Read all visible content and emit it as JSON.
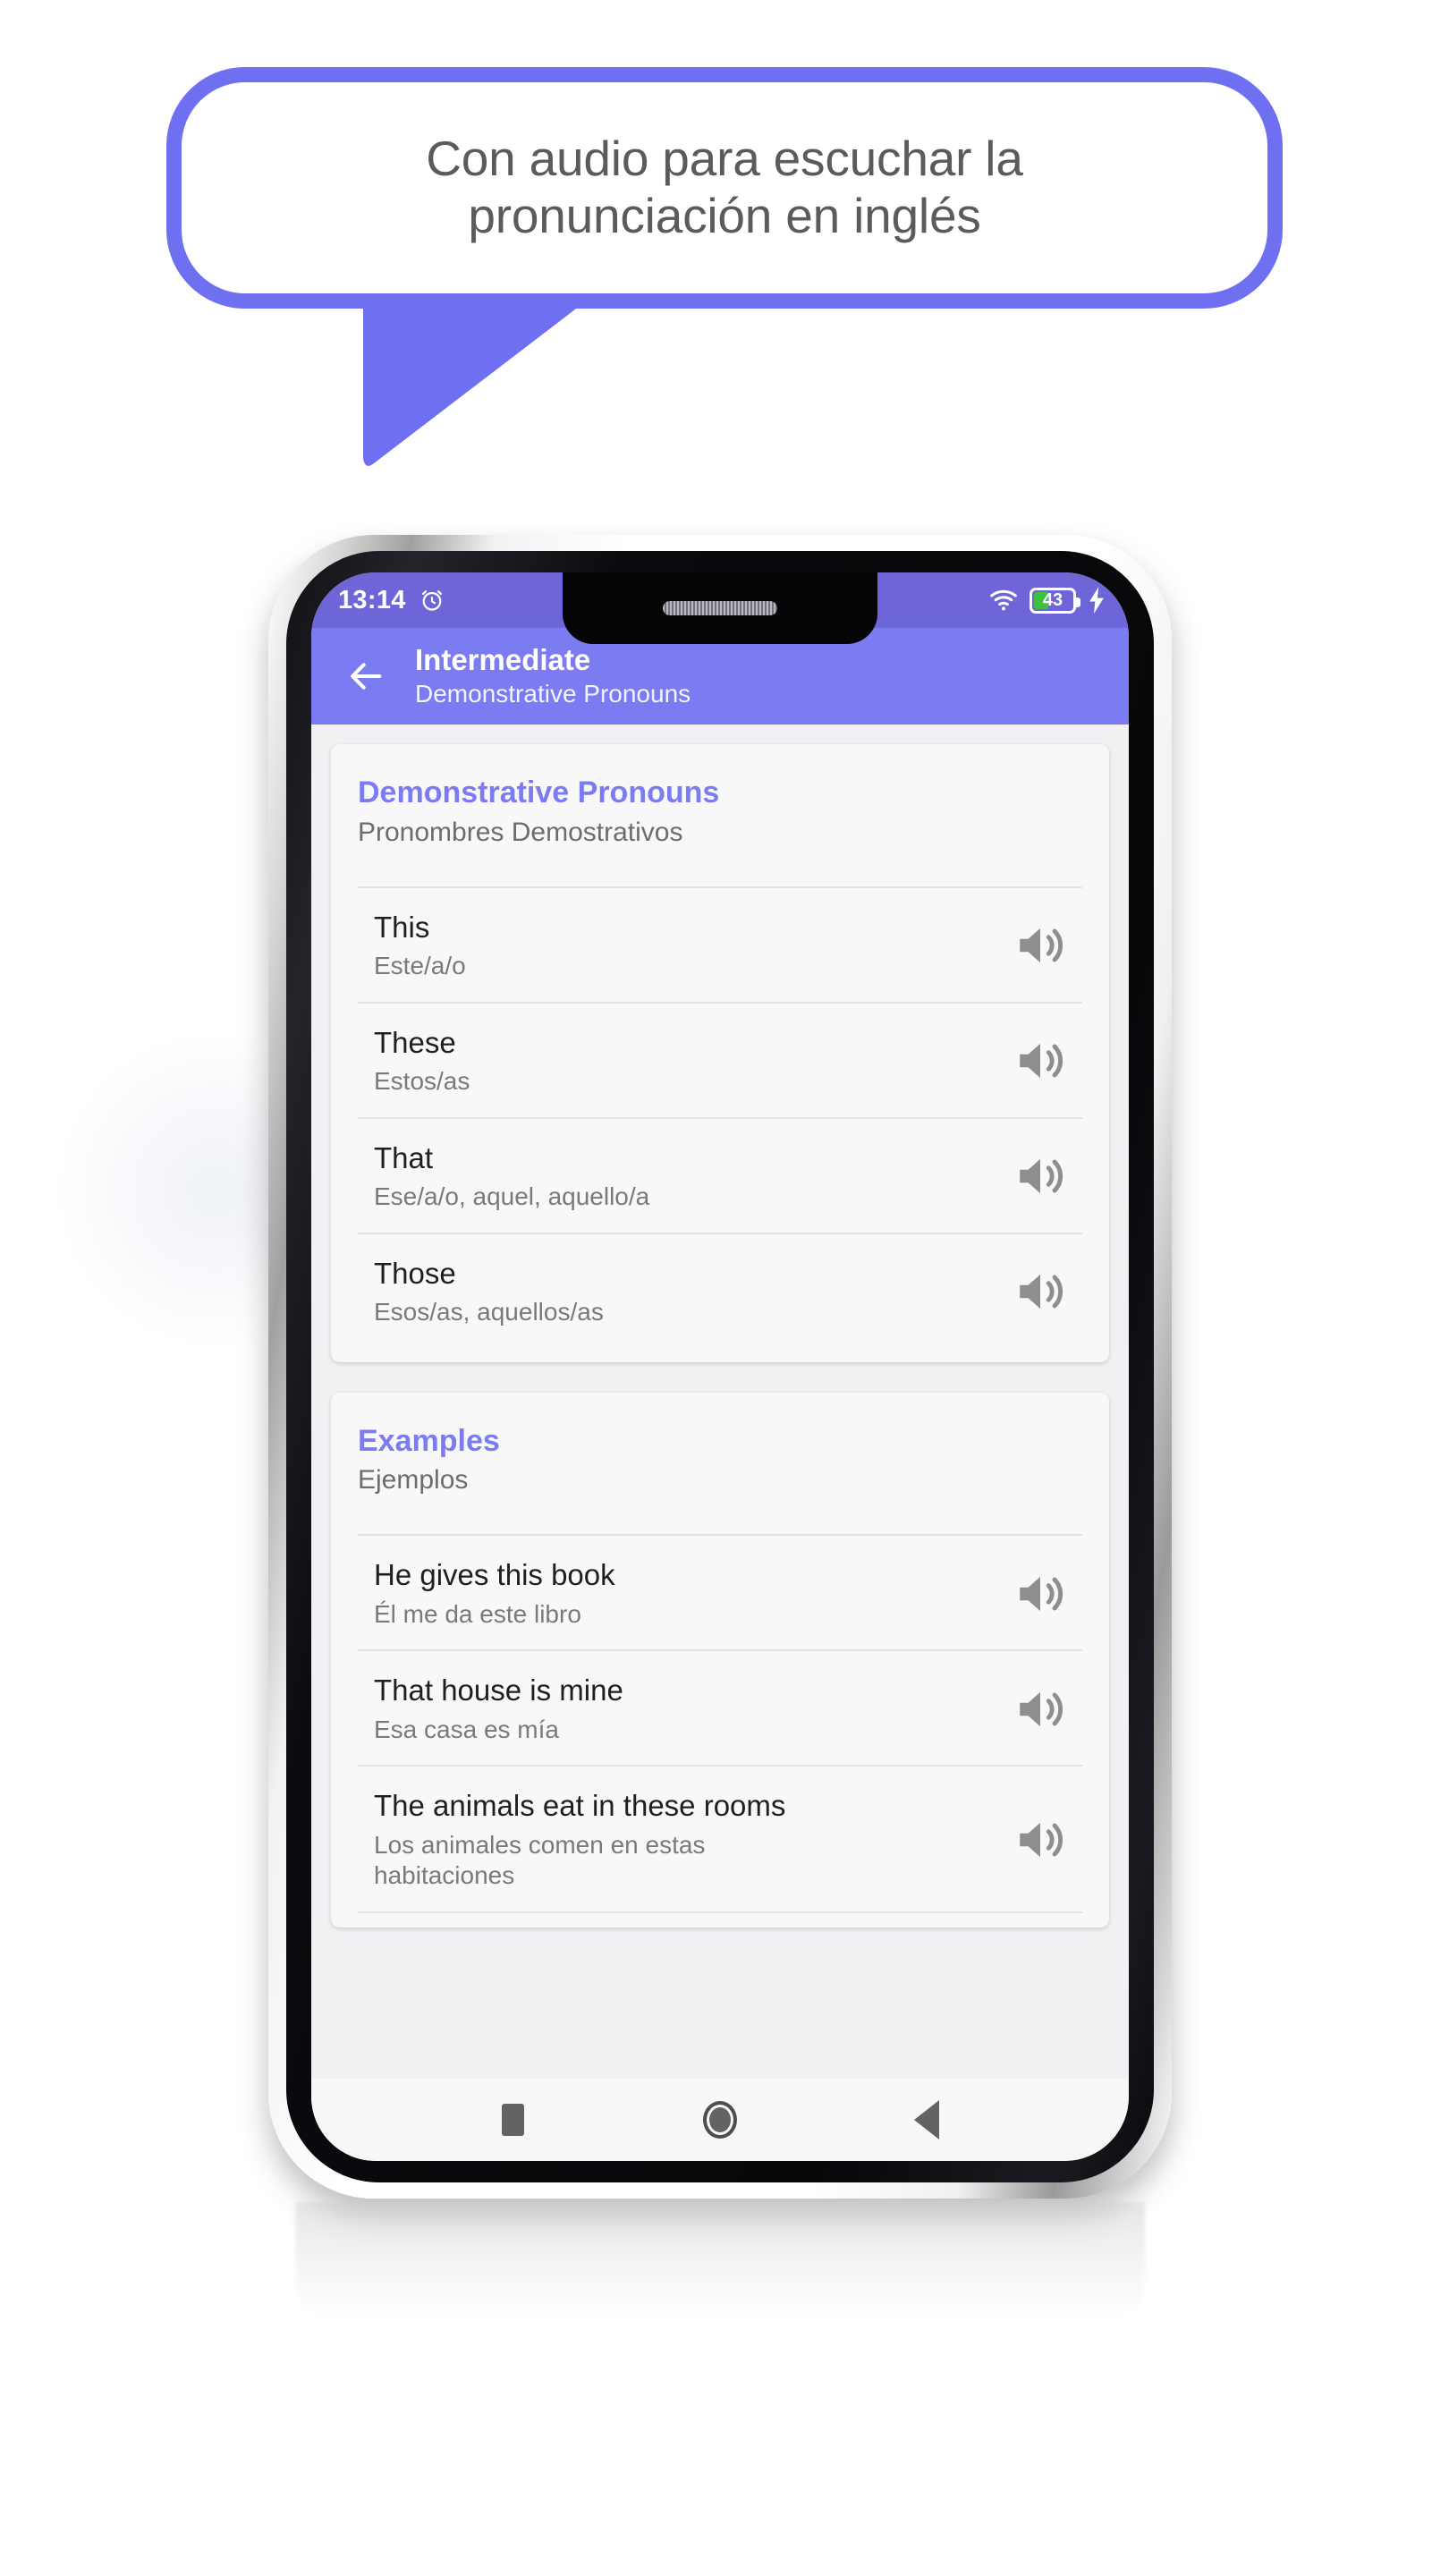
{
  "colors": {
    "accent": "#7b7bf2",
    "bubble_border": "#6f6ff2",
    "statusbar": "#6e66d8",
    "card_bg": "#f8f8f9",
    "screen_bg": "#f1f1f4",
    "battery_green": "#3ec13e",
    "text_primary": "#1f1f1f",
    "text_secondary": "#7a7a7a"
  },
  "promo": {
    "bubble_text": "Con audio para escuchar la\npronunciación en inglés",
    "tail_icon": "speech-bubble-tail"
  },
  "statusbar": {
    "time": "13:14",
    "alarm_icon": "alarm-clock-icon",
    "wifi_icon": "wifi-icon",
    "battery_icon": "battery-icon",
    "battery_level": "43",
    "charging_icon": "lightning-bolt-icon"
  },
  "appbar": {
    "back_icon": "arrow-left-icon",
    "title": "Intermediate",
    "subtitle": "Demonstrative Pronouns"
  },
  "cards": [
    {
      "title": "Demonstrative Pronouns",
      "subtitle": "Pronombres Demostrativos",
      "rows": [
        {
          "en": "This",
          "es": "Este/a/o",
          "audio_icon": "volume-up-icon"
        },
        {
          "en": "These",
          "es": "Estos/as",
          "audio_icon": "volume-up-icon"
        },
        {
          "en": "That",
          "es": "Ese/a/o, aquel, aquello/a",
          "audio_icon": "volume-up-icon"
        },
        {
          "en": "Those",
          "es": "Esos/as, aquellos/as",
          "audio_icon": "volume-up-icon"
        }
      ]
    },
    {
      "title": "Examples",
      "subtitle": "Ejemplos",
      "rows": [
        {
          "en": "He gives this book",
          "es": "Él me da este libro",
          "audio_icon": "volume-up-icon"
        },
        {
          "en": "That house is mine",
          "es": "Esa casa es mía",
          "audio_icon": "volume-up-icon"
        },
        {
          "en": "The animals eat in these rooms",
          "es": "Los animales comen en estas habitaciones",
          "audio_icon": "volume-up-icon"
        }
      ]
    }
  ],
  "navbar": {
    "recents_icon": "square-recents-icon",
    "home_icon": "circle-home-icon",
    "back_icon": "triangle-back-icon"
  }
}
